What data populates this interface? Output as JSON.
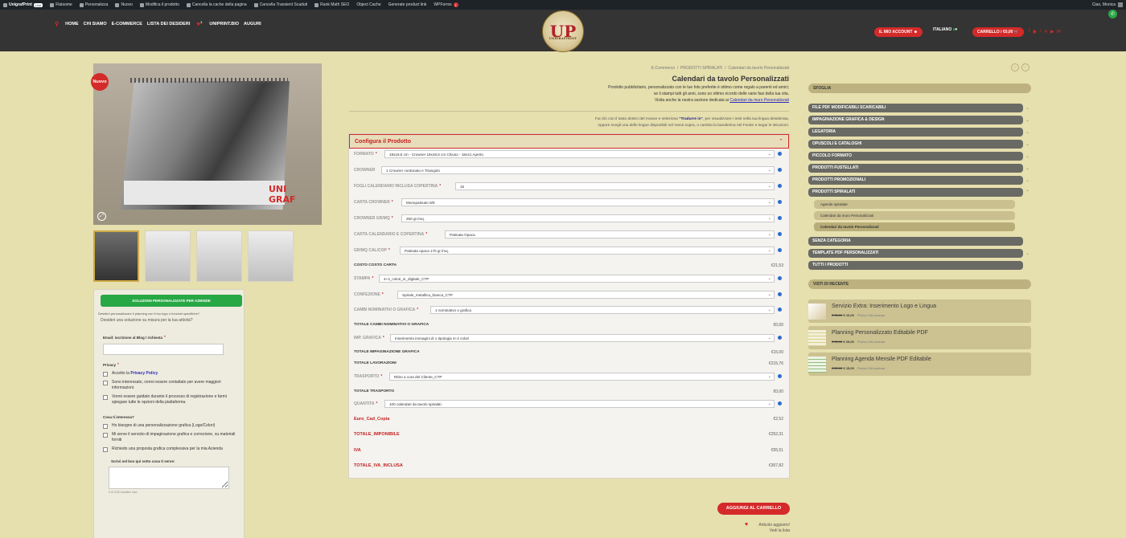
{
  "adminbar": {
    "brand": "UnigrafPrint",
    "live": "Live",
    "items": [
      "Flatsome",
      "Personalizza",
      "Nuovo",
      "Modifica il prodotto",
      "Cancella la cache della pagina",
      "Cancella Transient Scaduti",
      "Rank Math SEO",
      "Object Cache",
      "Generate product link",
      "WPForms"
    ],
    "wpforms_count": "1",
    "user": "Ciao, Monica"
  },
  "nav": {
    "items": [
      "HOME",
      "CHI SIAMO",
      "E-COMMERCE",
      "LISTA DEI DESIDERI",
      "UNIPRINT.BIO",
      "AUGURI"
    ],
    "wish_count": "1"
  },
  "logo": {
    "text": "UP",
    "subtext": "UNIGRAFPRINT"
  },
  "header_right": {
    "account": "IL MIO ACCOUNT",
    "language": "ITALIANO",
    "cart": "CARRELLO / €0,00"
  },
  "gallery": {
    "new_badge": "Nuovo",
    "zoom_icon": "zoom-icon",
    "thumb_count": 4
  },
  "leftform": {
    "cta": "SOLUZIONI PERSONALIZZATE PER AZIENDE",
    "question_small": "Desideri personalizzare il planning con il tuo logo o funzioni specifiche?",
    "question": "Desideri una soluzione su misura per la tua attività?",
    "email_label": "Email: iscrizione al Blog / richiesta",
    "privacy_label": "Privacy",
    "privacy_items": [
      {
        "pre": "Accetto la ",
        "link": "Privacy Policy"
      },
      {
        "pre": "Sono interessato, vorrei essere contattato per avere maggiori informazioni.",
        "link": ""
      },
      {
        "pre": "Vorrei essere guidato durante il processo di registrazione e farmi spiegare tutte le opzioni della piattaforma.",
        "link": ""
      }
    ],
    "interest_label": "Cosa ti interessa?",
    "interest_items": [
      "Ho bisogno di una personalizzazione grafica (Logo/Colori)",
      "Mi serve il servizio di impaginazione grafica e correzione, su materiali forniti",
      "Richiedo una proposta grafica complessiva per la mia Azienda"
    ],
    "textarea_label": "Scrivi nel box qui sotto cosa ti serve:",
    "char_count": "0 di 1000 caratteri max"
  },
  "product": {
    "breadcrumb": [
      "E-Commerce",
      "PRODOTTI SPIRALATI",
      "Calendari da tavolo Personalizzati"
    ],
    "title": "Calendari da tavolo Personalizzati",
    "desc_lines": [
      "Prodotto pubblicitario, personalizzato con le tue foto preferite è ottimo come regalo a parenti ed amici;",
      "se li stampi tutti gli anni, sono un ottimo ricordo delle varie fasi della tua vita."
    ],
    "desc_link_pre": "Visita anche la nostra sezione dedicata ai ",
    "desc_link": "Calendari da muro Personalizzati",
    "translate_pre": "Fai clic con il tasto destro del mouse e seleziona ",
    "translate_bold": "\"Tradurre in\"",
    "translate_post": ", per visualizzare i testi nella tua lingua desiderata,",
    "translate_line2": "oppure scegli una delle lingue disponibili nel menù sopra, o cambia la bandierina nel Footer e segui le istruzioni."
  },
  "config": {
    "title": "Configura il Prodotto",
    "options": [
      {
        "label": "FORMATO",
        "value": "19x18,5 cm - Crowner 19x18,5 cm Chiuso - 19x41 Aperto"
      },
      {
        "label": "CROWNER",
        "value": "1 Crowner cordonato e Triangolo"
      },
      {
        "label": "FOGLI CALENDARIO INCLUSA COPERTINA",
        "value": "15"
      },
      {
        "label": "CARTA CROWNER",
        "value": "Monopatinato 8/8"
      },
      {
        "label": "CROWNER GR/MQ",
        "value": "260 gr./mq."
      },
      {
        "label": "CARTA CALENDARIO E COPERTINA",
        "value": "Patinata Opaca"
      },
      {
        "label": "GR/MQ CAL/COP",
        "value": "Patinata opaca 170 gr./mq."
      },
      {
        "label": "STAMPA",
        "value": "4+4_colori_in_digitale_CTP"
      },
      {
        "label": "CONFEZIONE",
        "value": "Spirale_metallica_bianca_CTP"
      },
      {
        "label": "CAMBI NOMINATIVI O GRAFICA",
        "value": "1 nominativo o grafica"
      },
      {
        "label": "IMP. GRAFICA",
        "value": "Inserimento immagini di 1 tipologia 4+4 colori"
      },
      {
        "label": "TRASPORTO",
        "value": "Ritiro a cura del Cliente_CTP"
      },
      {
        "label": "QUANTITA",
        "value": "100 calendari da tavolo spiralati"
      }
    ],
    "totals": [
      {
        "label": "COSTO COSTO CARTA",
        "value": "€21,53"
      },
      {
        "label": "TOTALE CAMBI NOMINATIVI O GRAFICA",
        "value": "€0,00"
      },
      {
        "label": "TOTALE IMPAGINAZIONE GRAFICA",
        "value": "€15,00"
      },
      {
        "label": "TOTALE LAVORAZIONI",
        "value": "€215,76"
      },
      {
        "label": "TOTALE TRASPORTO",
        "value": "€0,00"
      }
    ],
    "summary": [
      {
        "label": "Euro_Cad_Copia",
        "value": "€2,52"
      },
      {
        "label": "TOTALE_IMPONIBILE",
        "value": "€252,31"
      },
      {
        "label": "IVA",
        "value": "€55,51"
      },
      {
        "label": "TOTALE_IVA_INCLUSA",
        "value": "€307,82"
      }
    ],
    "add_to_cart": "AGGIUNGI AL CARRELLO",
    "wishlist_added": "Articolo aggiunto!",
    "wishlist_view": "Vedi la lista"
  },
  "sidebar": {
    "browse_title": "SFOGLIA",
    "categories": [
      "FILE PDF MODIFICABILI SCARICABILI",
      "IMPAGINAZIONE GRAFICA & DESIGN",
      "LEGATORIA",
      "OPUSCOLI E CATALOGHI",
      "PICCOLO FORMATO",
      "PRODOTTI FUSTELLATI",
      "PRODOTTI PROMOZIONALI",
      "PRODOTTI SPIRALATI"
    ],
    "subcategories": [
      "Agende spiralate",
      "Calendari da muro Personalizzati",
      "Calendari da tavolo Personalizzati"
    ],
    "categories_after": [
      "SENZA CATEGORIA",
      "TEMPLATE PDF PERSONALIZZATI",
      "TUTTI I PRODOTTI"
    ],
    "recent_title": "VISTI DI RECENTE",
    "recent": [
      {
        "title": "Servizio Extra: Inserimento Logo e Lingua",
        "old": "€ 18,00",
        "new": "€ 10,00",
        "note": "Prezzo IVA esclusa"
      },
      {
        "title": "Planning Personalizzato Editabile PDF",
        "old": "€ 30,00",
        "new": "€ 25,00",
        "note": "Prezzo IVA esclusa"
      },
      {
        "title": "Planning Agenda Mensile PDF Editabile",
        "old": "€ 22,00",
        "new": "€ 15,00",
        "note": "Prezzo IVA esclusa"
      }
    ]
  },
  "colors": {
    "accent": "#d42a2a",
    "page_bg": "#e6dfae",
    "header_bg": "#343434",
    "green": "#28a745"
  }
}
